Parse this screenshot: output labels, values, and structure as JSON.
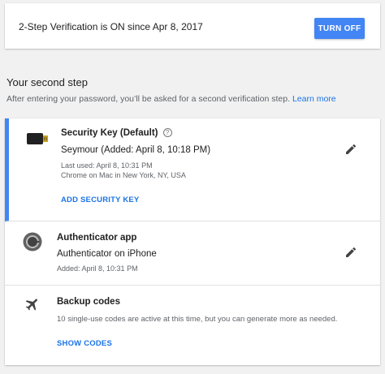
{
  "status": {
    "text": "2-Step Verification is ON since Apr 8, 2017",
    "turn_off_label": "TURN OFF"
  },
  "second_step": {
    "title": "Your second step",
    "description": "After entering your password, you’ll be asked for a second verification step.",
    "learn_more": "Learn more"
  },
  "security_key": {
    "title": "Security Key (Default)",
    "help_glyph": "?",
    "name": "Seymour (Added: April 8, 10:18 PM)",
    "last_used": "Last used: April 8, 10:31 PM",
    "location": "Chrome on Mac in New York, NY, USA",
    "add_label": "ADD SECURITY KEY",
    "icon": "usb-key-icon"
  },
  "authenticator": {
    "title": "Authenticator app",
    "device": "Authenticator on iPhone",
    "added": "Added: April 8, 10:31 PM",
    "icon": "authenticator-icon"
  },
  "backup": {
    "title": "Backup codes",
    "description": "10 single-use codes are active at this time, but you can generate more as needed.",
    "show_label": "SHOW CODES",
    "icon": "airplane-icon"
  },
  "colors": {
    "accent": "#4285f4",
    "link": "#1a73e8"
  }
}
